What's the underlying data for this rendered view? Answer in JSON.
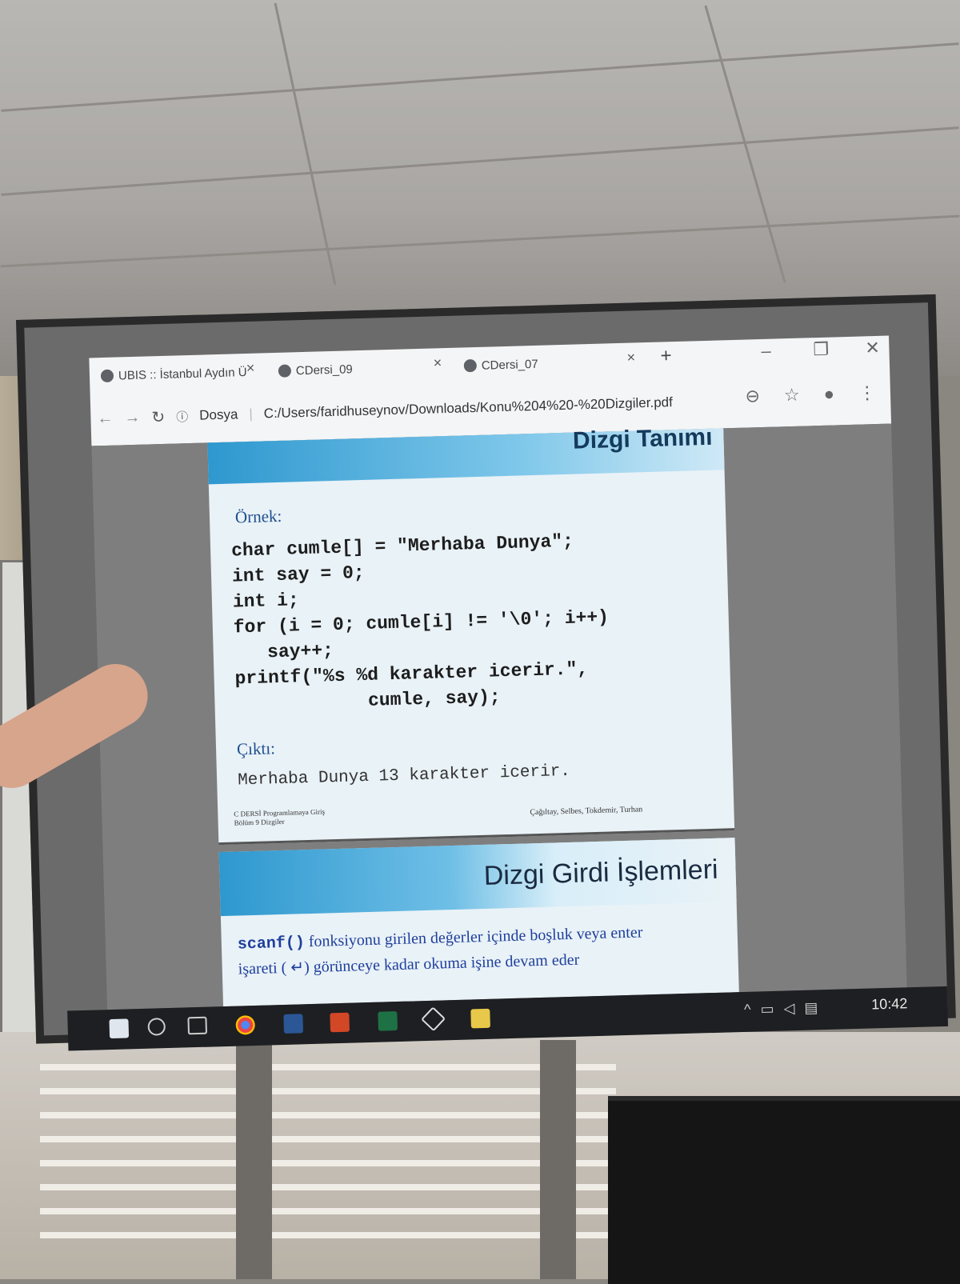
{
  "browser": {
    "tabs": [
      {
        "label": "UBIS :: İstanbul Aydın Ü"
      },
      {
        "label": "CDersi_09"
      },
      {
        "label": "CDersi_07"
      }
    ],
    "new_tab": "+",
    "address_prefix": "Dosya",
    "url": "C:/Users/faridhuseynov/Downloads/Konu%204%20-%20Dizgiler.pdf"
  },
  "slide1": {
    "banner_title": "Dizgi Tanımı",
    "example_label": "Örnek:",
    "code": "char cumle[] = \"Merhaba Dunya\";\nint say = 0;\nint i;\nfor (i = 0; cumle[i] != '\\0'; i++)\n   say++;\nprintf(\"%s %d karakter icerir.\",\n            cumle, say);",
    "output_label": "Çıktı:",
    "output": "Merhaba Dunya 13 karakter icerir.",
    "footer_left_1": "C DERSİ Programlamaya Giriş",
    "footer_left_2": "Bölüm 9 Dizgiler",
    "footer_right": "Çağıltay, Selbes, Tokdemir, Turhan"
  },
  "slide2": {
    "title": "Dizgi Girdi İşlemleri",
    "code_word": "scanf()",
    "text_1": " fonksiyonu girilen değerler içinde boşluk veya enter",
    "text_2": "işareti ( ↵) görünceye kadar okuma işine devam eder"
  },
  "taskbar": {
    "clock": "10:42"
  }
}
